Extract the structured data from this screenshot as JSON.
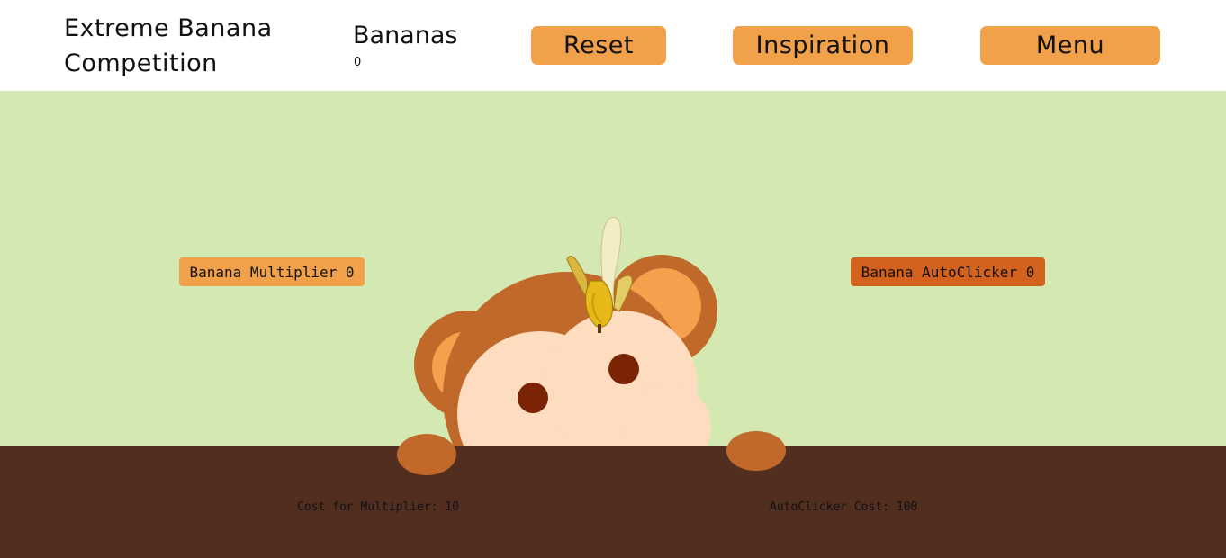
{
  "header": {
    "title_line1": "Extreme Banana",
    "title_line2": "Competition",
    "count_label": "Bananas",
    "count_value": "0",
    "reset_label": "Reset",
    "inspiration_label": "Inspiration",
    "menu_label": "Menu"
  },
  "upgrades": {
    "multiplier_label": "Banana Multiplier 0",
    "autoclicker_label": "Banana AutoClicker 0",
    "multiplier_cost": "Cost for Multiplier: 10",
    "autoclicker_cost": "AutoClicker Cost: 100"
  },
  "colors": {
    "button_orange": "#f0a14a",
    "autoclicker_orange": "#d4621f",
    "field_green": "#d4e8b2",
    "ground_brown": "#522e21",
    "monkey_brown": "#c0692a",
    "monkey_face": "#fddcbf",
    "eye_brown": "#7a2405"
  },
  "icons": {
    "clicker": "monkey-with-banana-icon"
  }
}
